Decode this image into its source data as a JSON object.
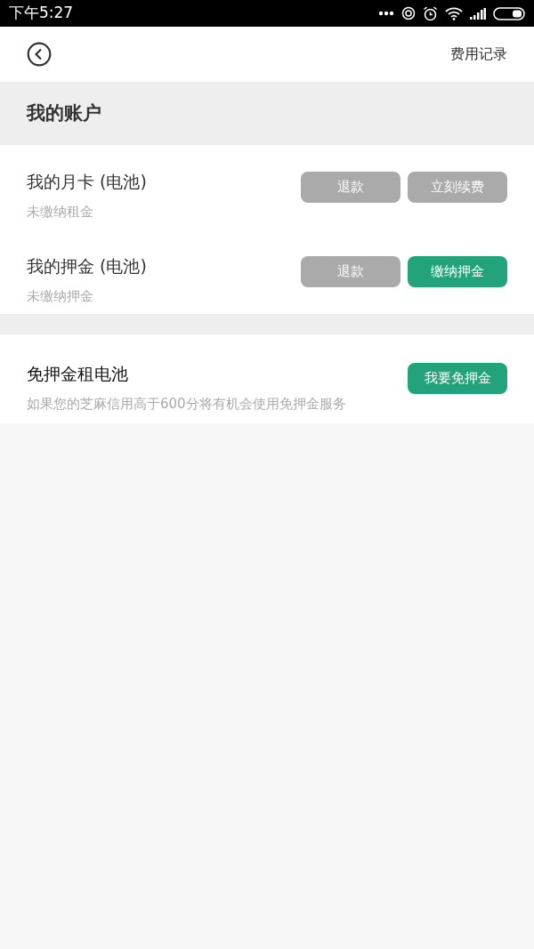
{
  "status_bar": {
    "time": "下午5:27"
  },
  "header": {
    "action": "费用记录"
  },
  "section": {
    "title": "我的账户"
  },
  "accounts": [
    {
      "title": "我的月卡 (电池)",
      "subtitle": "未缴纳租金",
      "buttons": [
        {
          "label": "退款",
          "kind": "grey"
        },
        {
          "label": "立刻续费",
          "kind": "grey"
        }
      ]
    },
    {
      "title": "我的押金 (电池)",
      "subtitle": "未缴纳押金",
      "buttons": [
        {
          "label": "退款",
          "kind": "grey"
        },
        {
          "label": "缴纳押金",
          "kind": "green"
        }
      ]
    }
  ],
  "deposit_free": {
    "title": "免押金租电池",
    "subtitle": "如果您的芝麻信用高于600分将有机会使用免押金服务",
    "buttons": [
      {
        "label": "我要免押金",
        "kind": "green"
      }
    ]
  }
}
